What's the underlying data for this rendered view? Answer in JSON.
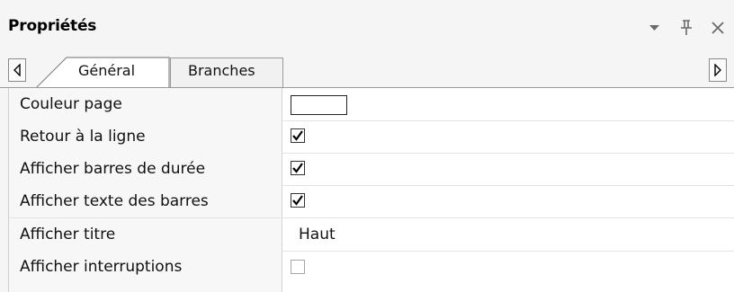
{
  "window": {
    "title": "Propriétés",
    "icons": [
      "chevron-down-icon",
      "pin-icon",
      "close-icon"
    ]
  },
  "tabs": [
    {
      "label": "Général",
      "active": true
    },
    {
      "label": "Branches",
      "active": false
    }
  ],
  "properties": [
    {
      "name": "Couleur page",
      "type": "color",
      "value": "#ffffff"
    },
    {
      "name": "Retour à la ligne",
      "type": "checkbox",
      "checked": true
    },
    {
      "name": "Afficher barres de durée",
      "type": "checkbox",
      "checked": true
    },
    {
      "name": "Afficher texte des barres",
      "type": "checkbox",
      "checked": true
    },
    {
      "name": "Afficher titre",
      "type": "text",
      "value": "Haut"
    },
    {
      "name": "Afficher interruptions",
      "type": "checkbox",
      "checked": false
    }
  ],
  "colors": {
    "panel_bg": "#f5f5f5",
    "grid_bg": "#ffffff",
    "border": "#9a9a9a",
    "icon": "#6a6a6a"
  }
}
